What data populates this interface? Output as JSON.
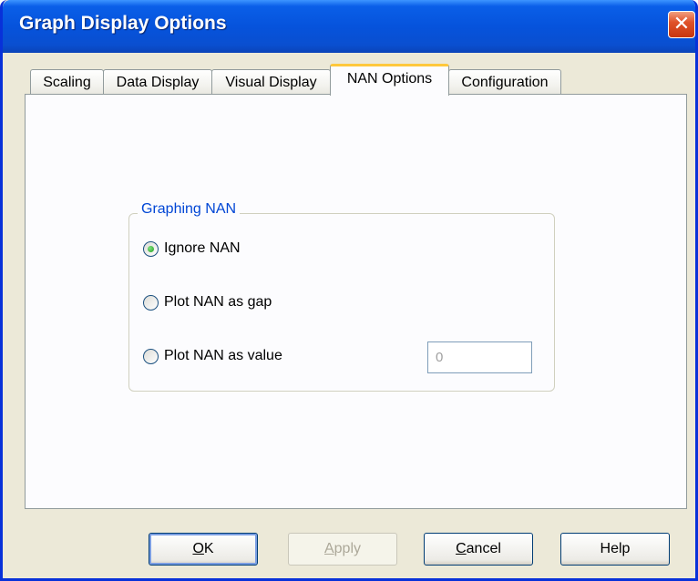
{
  "window": {
    "title": "Graph Display Options",
    "close_glyph": "✕"
  },
  "tabs": [
    {
      "label": "Scaling",
      "active": false
    },
    {
      "label": "Data Display",
      "active": false
    },
    {
      "label": "Visual Display",
      "active": false
    },
    {
      "label": "NAN Options",
      "active": true
    },
    {
      "label": "Configuration",
      "active": false
    }
  ],
  "group": {
    "label": "Graphing NAN",
    "options": [
      {
        "label": "Ignore NAN",
        "selected": true
      },
      {
        "label": "Plot NAN as gap",
        "selected": false
      },
      {
        "label": "Plot NAN as value",
        "selected": false
      }
    ],
    "value_field": {
      "value": "0",
      "enabled": false
    }
  },
  "buttons": {
    "ok": {
      "mnemonic": "O",
      "rest": "K"
    },
    "apply": {
      "mnemonic": "A",
      "rest": "pply",
      "enabled": false
    },
    "cancel": {
      "mnemonic": "C",
      "rest": "ancel"
    },
    "help": {
      "label": "Help"
    }
  },
  "colors": {
    "titlebar": "#0653dc",
    "group_label": "#0046d5",
    "active_tab_highlight": "#ffc83c"
  }
}
